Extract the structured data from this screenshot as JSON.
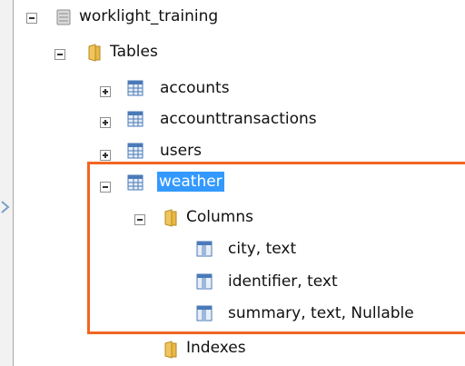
{
  "tree": {
    "database": {
      "label": "worklight_training",
      "icon": "database-icon",
      "expanded": true
    },
    "tables_folder": {
      "label": "Tables",
      "icon": "folder-icon",
      "expanded": true
    },
    "tables": [
      {
        "label": "accounts",
        "icon": "table-icon",
        "expanded": false
      },
      {
        "label": "accounttransactions",
        "icon": "table-icon",
        "expanded": false
      },
      {
        "label": "users",
        "icon": "table-icon",
        "expanded": false
      }
    ],
    "weather": {
      "label": "weather",
      "icon": "table-icon",
      "expanded": true,
      "selected": true,
      "columns_folder": {
        "label": "Columns",
        "icon": "folder-icon",
        "expanded": true
      },
      "columns": [
        {
          "label": "city, text",
          "icon": "column-icon"
        },
        {
          "label": "identifier, text",
          "icon": "column-icon"
        },
        {
          "label": "summary, text, Nullable",
          "icon": "column-icon"
        }
      ]
    },
    "indexes_folder": {
      "label": "Indexes",
      "icon": "folder-icon"
    }
  },
  "colors": {
    "highlight_border": "#f26522",
    "selection": "#3399ff",
    "folder": "#e8b84a",
    "table_icon": "#4a7ab8"
  }
}
